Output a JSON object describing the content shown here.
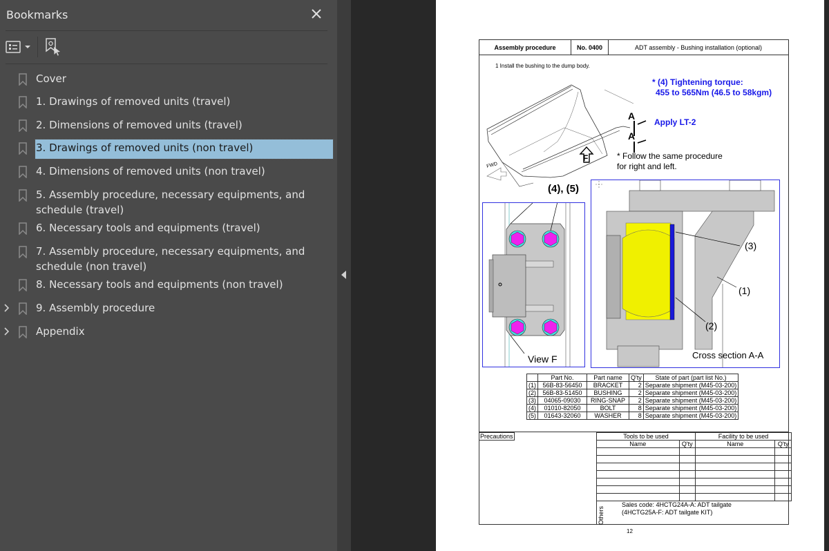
{
  "sidebar": {
    "title": "Bookmarks",
    "close_icon": "close-icon",
    "toolbar": {
      "options_icon": "list-options-icon",
      "options_dropdown_icon": "chevron-down-icon",
      "find_current_icon": "find-current-bookmark-icon"
    },
    "items": [
      {
        "label": "Cover",
        "expandable": false,
        "selected": false
      },
      {
        "label": "1. Drawings of removed units (travel)",
        "expandable": false,
        "selected": false
      },
      {
        "label": "2. Dimensions of removed units (travel)",
        "expandable": false,
        "selected": false
      },
      {
        "label": "3. Drawings of removed units (non travel)",
        "expandable": false,
        "selected": true
      },
      {
        "label": "4. Dimensions of removed units (non travel)",
        "expandable": false,
        "selected": false
      },
      {
        "label": "5. Assembly procedure, necessary equipments, and schedule (travel)",
        "expandable": false,
        "selected": false
      },
      {
        "label": "6. Necessary tools and equipments (travel)",
        "expandable": false,
        "selected": false
      },
      {
        "label": "7. Assembly procedure, necessary equipments, and schedule (non travel)",
        "expandable": false,
        "selected": false
      },
      {
        "label": "8. Necessary tools and equipments (non travel)",
        "expandable": false,
        "selected": false
      },
      {
        "label": "9. Assembly procedure",
        "expandable": true,
        "selected": false
      },
      {
        "label": "Appendix",
        "expandable": true,
        "selected": false
      }
    ],
    "selected_color": "#94bed9"
  },
  "splitter": {
    "collapse_icon": "collapse-left-icon"
  },
  "document": {
    "header": {
      "section": "Assembly procedure",
      "number": "No. 0400",
      "title": "ADT assembly - Bushing installation (optional)"
    },
    "step": "1 Install the bushing to the dump body.",
    "notes": {
      "torque_line1": "* (4) Tightening torque:",
      "torque_line2": "455 to 565Nm  (46.5 to 58kgm)",
      "apply": "Apply LT-2",
      "follow_line1": "* Follow the same procedure",
      "follow_line2": "for right and left.",
      "accent_color": "#1818e8"
    },
    "figure_labels": {
      "section_a_top": "A",
      "section_a_bottom": "A",
      "view_arrow": "F",
      "fwd": "FWD",
      "callout_45": "(4), (5)",
      "view_f": "View F",
      "callout_1": "(1)",
      "callout_2": "(2)",
      "callout_3": "(3)",
      "cross_section": "Cross section A-A"
    },
    "parts_table": {
      "headers": [
        "",
        "Part No.",
        "Part name",
        "Q'ty",
        "State of part (part list No.)"
      ],
      "rows": [
        [
          "(1)",
          "56B-83-56450",
          "BRACKET",
          "2",
          "Separate shipment (M45-03-200)"
        ],
        [
          "(2)",
          "56B-83-51450",
          "BUSHING",
          "2",
          "Separate shipment (M45-03-200)"
        ],
        [
          "(3)",
          "04065-09030",
          "RING-SNAP",
          "2",
          "Separate shipment (M45-03-200)"
        ],
        [
          "(4)",
          "01010-82050",
          "BOLT",
          "8",
          "Separate shipment (M45-03-200)"
        ],
        [
          "(5)",
          "01643-32060",
          "WASHER",
          "8",
          "Separate shipment (M45-03-200)"
        ]
      ]
    },
    "precautions_label": "Precautions",
    "tools": {
      "tools_header": "Tools to be used",
      "facility_header": "Facility to be used",
      "name_col": "Name",
      "qty_col": "Q'ty"
    },
    "others": {
      "label": "Others",
      "line1": "Sales code: 4HCTG24A-A: ADT tailgate",
      "line2": "(4HCTG25A-F: ADT tailgate  KIT)"
    },
    "page_number": "12"
  }
}
